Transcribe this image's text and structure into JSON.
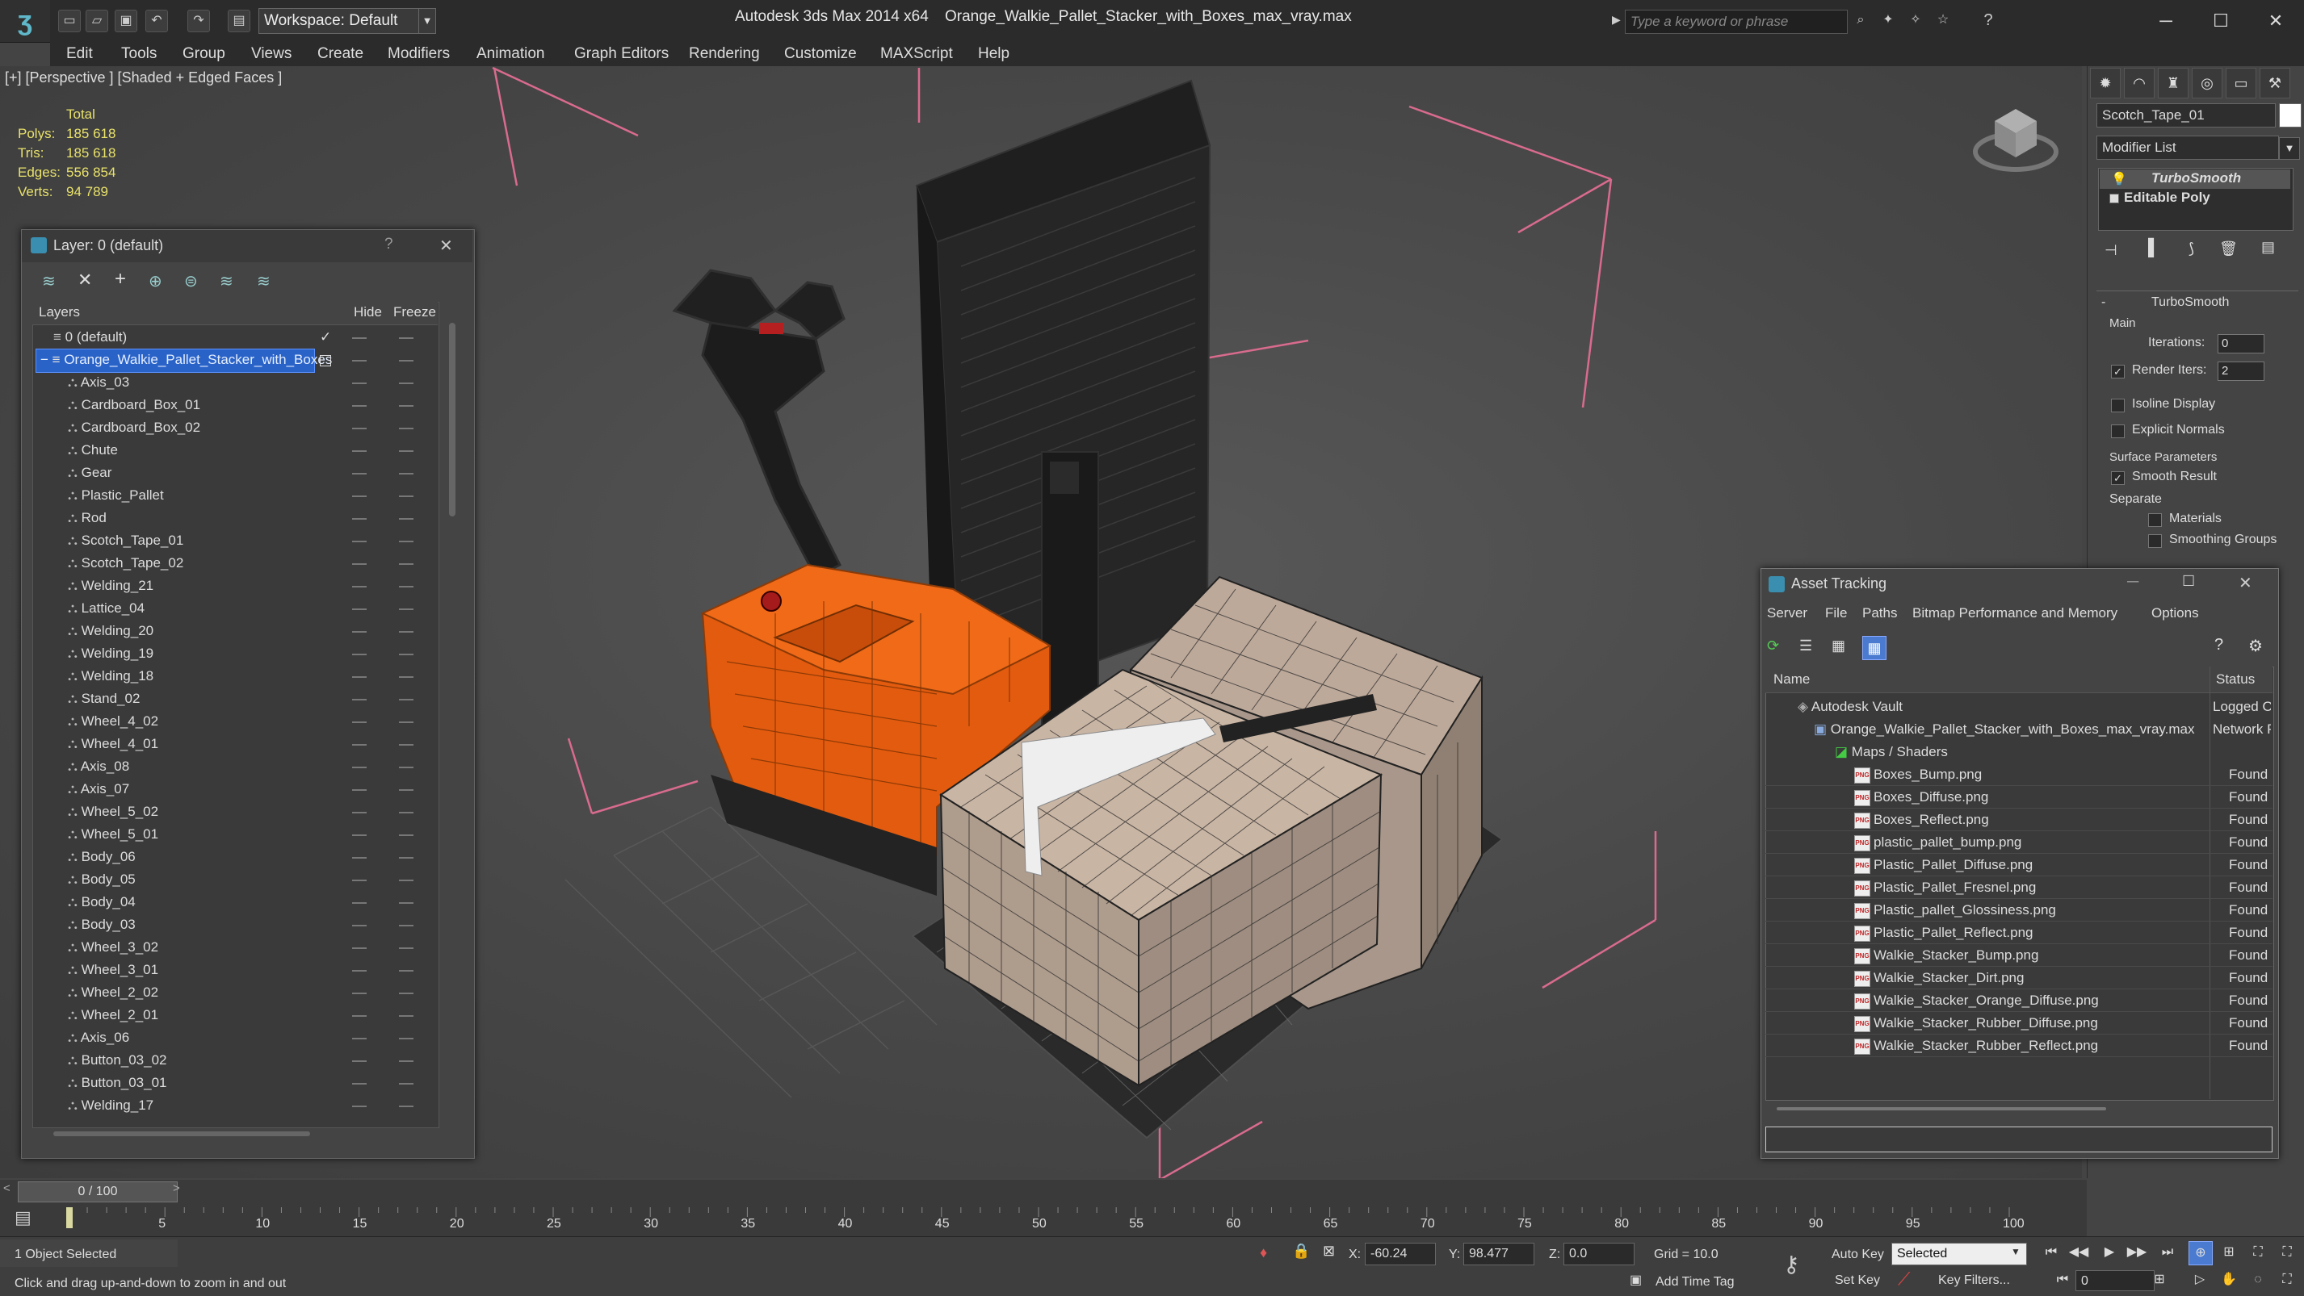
{
  "titlebar": {
    "workspace": "Workspace: Default",
    "app_title": "Autodesk 3ds Max  2014 x64",
    "file_title": "Orange_Walkie_Pallet_Stacker_with_Boxes_max_vray.max",
    "search_placeholder": "Type a keyword or phrase"
  },
  "menu": [
    "Edit",
    "Tools",
    "Group",
    "Views",
    "Create",
    "Modifiers",
    "Animation",
    "Graph Editors",
    "Rendering",
    "Customize",
    "MAXScript",
    "Help"
  ],
  "viewport": {
    "label": "[+] [Perspective ] [Shaded + Edged Faces ]",
    "stats": {
      "total_label": "Total",
      "polys_label": "Polys:",
      "polys": "185 618",
      "tris_label": "Tris:",
      "tris": "185 618",
      "edges_label": "Edges:",
      "edges": "556 854",
      "verts_label": "Verts:",
      "verts": "94 789"
    }
  },
  "layer_dialog": {
    "title": "Layer: 0 (default)",
    "col_layers": "Layers",
    "col_hide": "Hide",
    "col_freeze": "Freeze",
    "layer_default": "0 (default)",
    "layer_selected": "Orange_Walkie_Pallet_Stacker_with_Boxes",
    "objects": [
      "Axis_03",
      "Cardboard_Box_01",
      "Cardboard_Box_02",
      "Chute",
      "Gear",
      "Plastic_Pallet",
      "Rod",
      "Scotch_Tape_01",
      "Scotch_Tape_02",
      "Welding_21",
      "Lattice_04",
      "Welding_20",
      "Welding_19",
      "Welding_18",
      "Stand_02",
      "Wheel_4_02",
      "Wheel_4_01",
      "Axis_08",
      "Axis_07",
      "Wheel_5_02",
      "Wheel_5_01",
      "Body_06",
      "Body_05",
      "Body_04",
      "Body_03",
      "Wheel_3_02",
      "Wheel_3_01",
      "Wheel_2_02",
      "Wheel_2_01",
      "Axis_06",
      "Button_03_02",
      "Button_03_01",
      "Welding_17"
    ]
  },
  "command_panel": {
    "object_name": "Scotch_Tape_01",
    "modifier_list": "Modifier List",
    "stack": [
      "TurboSmooth",
      "Editable Poly"
    ],
    "rollout_title": "TurboSmooth",
    "main_label": "Main",
    "iterations_label": "Iterations:",
    "iterations": "0",
    "render_iters_label": "Render Iters:",
    "render_iters": "2",
    "isoline_label": "Isoline Display",
    "explicit_normals_label": "Explicit Normals",
    "surface_params_label": "Surface Parameters",
    "smooth_result_label": "Smooth Result",
    "separate_label": "Separate",
    "materials_label": "Materials",
    "smoothing_groups_label": "Smoothing Groups"
  },
  "asset_tracking": {
    "title": "Asset Tracking",
    "menu": [
      "Server",
      "File",
      "Paths",
      "Bitmap Performance and Memory",
      "Options"
    ],
    "col_name": "Name",
    "col_status": "Status",
    "vault": {
      "name": "Autodesk Vault",
      "status": "Logged O"
    },
    "file": {
      "name": "Orange_Walkie_Pallet_Stacker_with_Boxes_max_vray.max",
      "status": "Network P"
    },
    "maps_folder": "Maps / Shaders",
    "maps": [
      {
        "name": "Boxes_Bump.png",
        "status": "Found"
      },
      {
        "name": "Boxes_Diffuse.png",
        "status": "Found"
      },
      {
        "name": "Boxes_Reflect.png",
        "status": "Found"
      },
      {
        "name": "plastic_pallet_bump.png",
        "status": "Found"
      },
      {
        "name": "Plastic_Pallet_Diffuse.png",
        "status": "Found"
      },
      {
        "name": "Plastic_Pallet_Fresnel.png",
        "status": "Found"
      },
      {
        "name": "Plastic_pallet_Glossiness.png",
        "status": "Found"
      },
      {
        "name": "Plastic_Pallet_Reflect.png",
        "status": "Found"
      },
      {
        "name": "Walkie_Stacker_Bump.png",
        "status": "Found"
      },
      {
        "name": "Walkie_Stacker_Dirt.png",
        "status": "Found"
      },
      {
        "name": "Walkie_Stacker_Orange_Diffuse.png",
        "status": "Found"
      },
      {
        "name": "Walkie_Stacker_Rubber_Diffuse.png",
        "status": "Found"
      },
      {
        "name": "Walkie_Stacker_Rubber_Reflect.png",
        "status": "Found"
      }
    ]
  },
  "timeline": {
    "frame_counter": "0 / 100",
    "ticks": [
      "5",
      "10",
      "15",
      "20",
      "25",
      "30",
      "35",
      "40",
      "45",
      "50",
      "55",
      "60",
      "65",
      "70",
      "75",
      "80",
      "85",
      "90",
      "95",
      "100"
    ]
  },
  "status": {
    "selection": "1 Object Selected",
    "prompt": "Click and drag up-and-down to zoom in and out",
    "x_label": "X:",
    "x": "-60.24",
    "y_label": "Y:",
    "y": "98.477",
    "z_label": "Z:",
    "z": "0.0",
    "grid": "Grid = 10.0",
    "add_time_tag": "Add Time Tag",
    "auto_key": "Auto Key",
    "set_key": "Set Key",
    "key_mode": "Selected",
    "key_filters": "Key Filters...",
    "frame": "0"
  }
}
